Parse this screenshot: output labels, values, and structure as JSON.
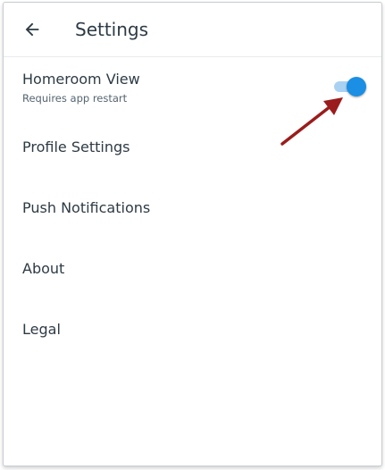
{
  "header": {
    "title": "Settings",
    "back_icon": "arrow-left-icon"
  },
  "settings": {
    "homeroom": {
      "label": "Homeroom View",
      "sublabel": "Requires app restart",
      "enabled": true
    },
    "items": [
      {
        "label": "Profile Settings"
      },
      {
        "label": "Push Notifications"
      },
      {
        "label": "About"
      },
      {
        "label": "Legal"
      }
    ]
  },
  "colors": {
    "accent": "#1a8fe3",
    "track": "#a9d2f2",
    "text": "#2d3b45",
    "annotation": "#9b1c1c"
  }
}
